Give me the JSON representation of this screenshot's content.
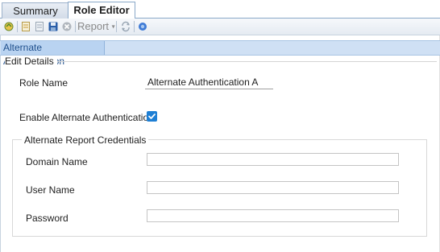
{
  "tabs": [
    {
      "label": "Summary"
    },
    {
      "label": "Role Editor"
    }
  ],
  "toolbar": {
    "icons": [
      "refresh-icon",
      "new-document-icon",
      "edit-document-icon",
      "save-icon",
      "cancel-icon",
      "refresh-arrows-icon",
      "help-icon"
    ],
    "report_label": "Report"
  },
  "subtab": {
    "label": "Alternate Authentication"
  },
  "edit_details": {
    "legend": "Edit Details",
    "role_name_label": "Role Name",
    "role_name_value": "Alternate Authentication A",
    "enable_label": "Enable Alternate Authentication",
    "enable_checked": true
  },
  "credentials": {
    "legend": "Alternate Report Credentials",
    "domain_label": "Domain Name",
    "domain_value": "",
    "user_label": "User Name",
    "user_value": "",
    "password_label": "Password",
    "password_value": ""
  },
  "colors": {
    "accent": "#1e7fd4",
    "subtab_bg": "#b9d3f1",
    "subtab_text": "#1f4f8c"
  }
}
